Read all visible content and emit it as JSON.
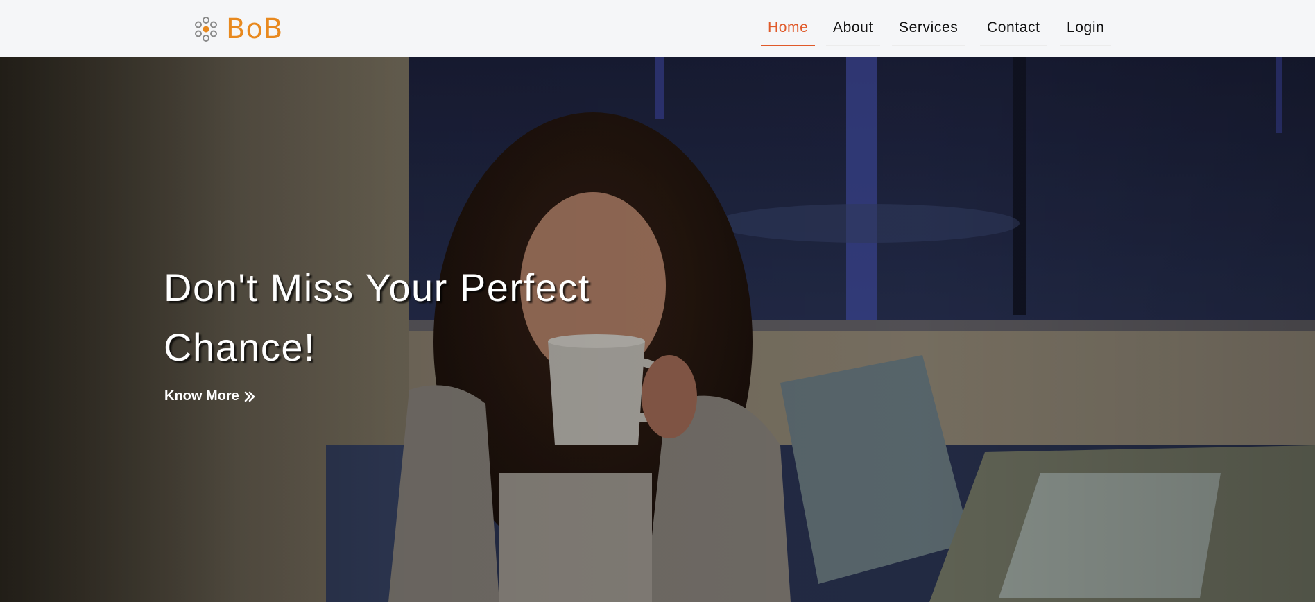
{
  "brand": {
    "name": "BoB",
    "logo_icon": "dots-cluster-icon",
    "color": "#e8891f"
  },
  "nav": {
    "items": [
      {
        "label": "Home",
        "active": true
      },
      {
        "label": "About",
        "active": false
      },
      {
        "label": "Services",
        "active": false
      },
      {
        "label": "Contact",
        "active": false
      },
      {
        "label": "Login",
        "active": false
      }
    ],
    "active_color": "#e05a2a"
  },
  "hero": {
    "title_line1": "Don't Miss Your Perfect",
    "title_line2": "Chance!",
    "cta_label": "Know More",
    "cta_icon": "double-chevron-right-icon",
    "image_subject": "woman-drinking-coffee-photo"
  }
}
